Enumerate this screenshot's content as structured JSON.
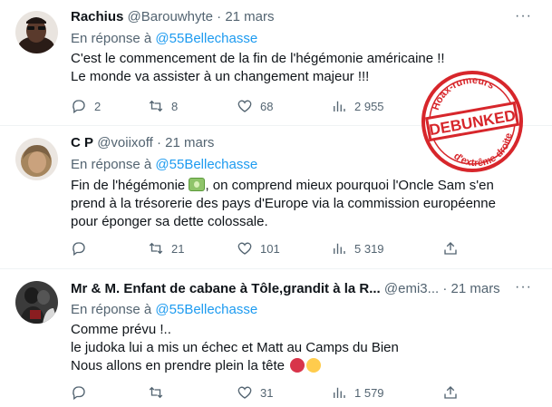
{
  "tweets": [
    {
      "name": "Rachius",
      "handle": "@Barouwhyte",
      "date": "21 mars",
      "reply_prefix": "En réponse à",
      "reply_to": "@55Bellechasse",
      "lines": [
        "C'est le commencement de la fin de l'hégémonie américaine !!",
        "Le monde va assister à un changement majeur !!!"
      ],
      "stats": {
        "replies": "2",
        "retweets": "8",
        "likes": "68",
        "views": "2 955"
      }
    },
    {
      "name": "C P",
      "handle": "@voiixoff",
      "date": "21 mars",
      "reply_prefix": "En réponse à",
      "reply_to": "@55Bellechasse",
      "lines": [
        "Fin de l'hégémonie",
        ", on comprend mieux pourquoi l'Oncle Sam s'en",
        "prend à la trésorerie des pays d'Europe via la commission européenne",
        "pour éponger sa dette colossale."
      ],
      "stats": {
        "replies": "",
        "retweets": "21",
        "likes": "101",
        "views": "5 319"
      }
    },
    {
      "name": "Mr & M. Enfant de cabane à Tôle,grandit à la R...",
      "handle": "@emi3...",
      "date": "21 mars",
      "reply_prefix": "En réponse à",
      "reply_to": "@55Bellechasse",
      "lines": [
        "Comme prévu !..",
        "le judoka lui a mis un échec et Matt au Camps du Bien",
        "Nous allons en prendre plein la tête"
      ],
      "stats": {
        "replies": "",
        "retweets": "",
        "likes": "31",
        "views": "1 579"
      }
    }
  ],
  "stamp": {
    "top_text": "Hoax-rumeurs",
    "main_text": "DEBUNKED",
    "bottom_text": "d'extrême-droite",
    "color": "#d7262b"
  },
  "colors": {
    "accent": "#1d9bf0",
    "secondary_text": "#536471",
    "text": "#0f1419",
    "divider": "#eff3f4"
  },
  "icons": [
    "reply-icon",
    "retweet-icon",
    "like-icon",
    "views-icon",
    "share-icon",
    "more-icon",
    "money-emoji",
    "angry-face-emoji",
    "crying-face-emoji"
  ]
}
